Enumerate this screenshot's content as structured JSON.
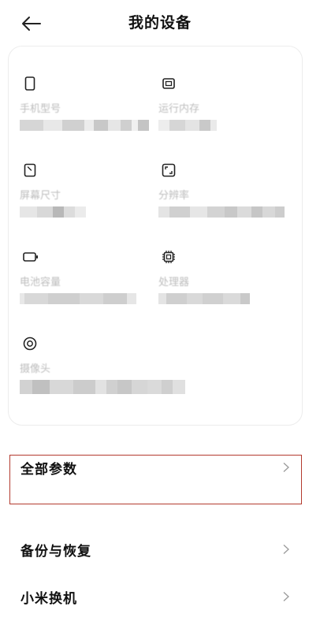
{
  "header": {
    "title": "我的设备",
    "back_icon": "arrow-left-icon"
  },
  "specs": [
    {
      "id": "phone-model",
      "icon": "phone-icon",
      "label": "手机型号"
    },
    {
      "id": "ram",
      "icon": "memory-chip-icon",
      "label": "运行内存"
    },
    {
      "id": "screen-size",
      "icon": "screen-size-icon",
      "label": "屏幕尺寸"
    },
    {
      "id": "resolution",
      "icon": "resolution-frame-icon",
      "label": "分辨率"
    },
    {
      "id": "battery",
      "icon": "battery-icon",
      "label": "电池容量"
    },
    {
      "id": "processor",
      "icon": "processor-icon",
      "label": "处理器"
    },
    {
      "id": "camera",
      "icon": "camera-lens-icon",
      "label": "摄像头"
    }
  ],
  "menu": [
    {
      "id": "all-params",
      "label": "全部参数",
      "highlighted": true
    },
    {
      "id": "backup-restore",
      "label": "备份与恢复"
    },
    {
      "id": "mi-mover",
      "label": "小米换机"
    }
  ],
  "colors": {
    "highlight_border": "#b33a2e",
    "label_gray": "#bdbdbd"
  }
}
